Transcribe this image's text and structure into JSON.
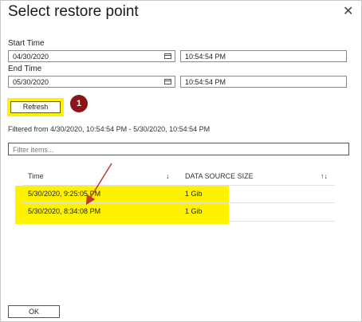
{
  "dialog": {
    "title": "Select restore point",
    "close_glyph": "✕"
  },
  "start_time": {
    "label": "Start Time",
    "date": "04/30/2020",
    "time": "10:54:54 PM"
  },
  "end_time": {
    "label": "End Time",
    "date": "05/30/2020",
    "time": "10:54:54 PM"
  },
  "refresh": {
    "label": "Refresh"
  },
  "callout": {
    "number": "1"
  },
  "filtered_text": "Filtered from 4/30/2020, 10:54:54 PM - 5/30/2020, 10:54:54 PM",
  "filter": {
    "placeholder": "Filter items..."
  },
  "table": {
    "headers": {
      "time": "Time",
      "size": "DATA SOURCE SIZE",
      "sort_down": "↓",
      "sort_both": "↑↓"
    },
    "rows": [
      {
        "time": "5/30/2020, 9:25:05 PM",
        "size": "1 Gib"
      },
      {
        "time": "5/30/2020, 8:34:08 PM",
        "size": "1 Gib"
      }
    ]
  },
  "ok": {
    "label": "OK"
  },
  "colors": {
    "highlight": "#fff200",
    "callout": "#8a1418",
    "arrow": "#c0392b"
  },
  "icons": [
    "close-icon",
    "calendar-icon",
    "sort-icon",
    "annotation-arrow"
  ]
}
